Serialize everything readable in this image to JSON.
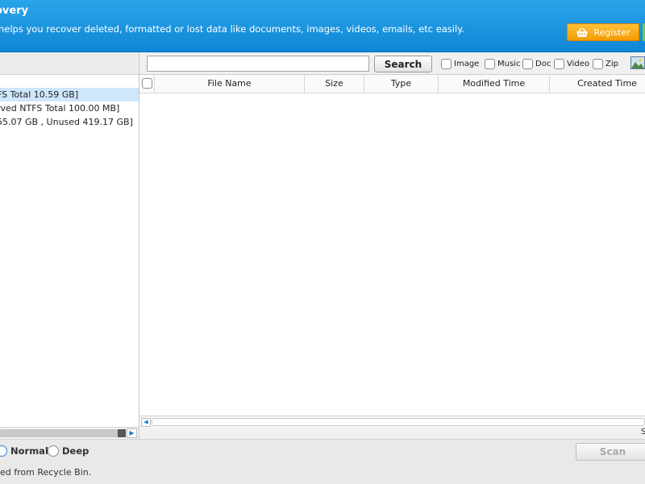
{
  "header": {
    "title": "overy",
    "description": "helps you recover deleted, formatted or lost data like documents, images, videos, emails, etc easily.",
    "register_label": "Register"
  },
  "drives": [
    {
      "label": "FS Total 10.59 GB]",
      "selected": true
    },
    {
      "label": "rved NTFS Total 100.00 MB]",
      "selected": false
    },
    {
      "label": "55.07 GB , Unused 419.17 GB]",
      "selected": false
    }
  ],
  "search": {
    "value": "",
    "placeholder": "",
    "button_label": "Search"
  },
  "filters": [
    "Image",
    "Music",
    "Doc",
    "Video",
    "Zip"
  ],
  "table": {
    "columns": [
      "File Name",
      "Size",
      "Type",
      "Modified Time",
      "Created Time"
    ],
    "rows": []
  },
  "status_text": "S",
  "scan_modes": [
    "Normal",
    "Deep"
  ],
  "selected_scan_mode": "Normal",
  "scan_label": "Scan",
  "hint": "ed from Recycle Bin."
}
